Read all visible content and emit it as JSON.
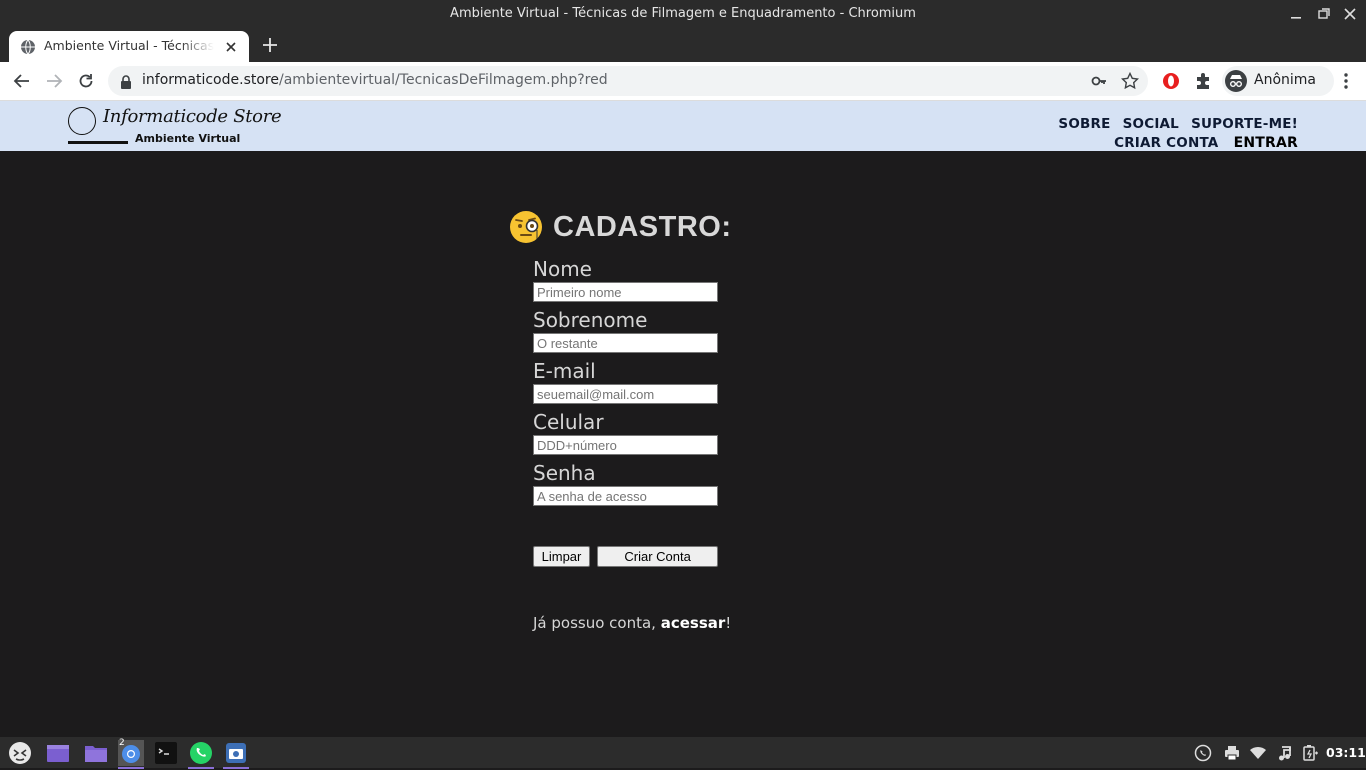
{
  "window": {
    "title": "Ambiente Virtual - Técnicas de Filmagem e Enquadramento - Chromium"
  },
  "tab": {
    "title": "Ambiente Virtual - Técnicas de Filmagem e Enquadramento"
  },
  "addressbar": {
    "host": "informaticode.store",
    "path": "/ambientevirtual/TecnicasDeFilmagem.php?red"
  },
  "profile": {
    "label": "Anônima"
  },
  "site": {
    "brand": "Informaticode Store",
    "subtitle": "Ambiente Virtual",
    "nav": {
      "sobre": "SOBRE",
      "social": "SOCIAL",
      "suporte": "SUPORTE-ME!",
      "criar_conta": "CRIAR CONTA",
      "entrar": "ENTRAR"
    }
  },
  "form": {
    "heading": "CADASTRO:",
    "fields": [
      {
        "label": "Nome",
        "placeholder": "Primeiro nome",
        "value": ""
      },
      {
        "label": "Sobrenome",
        "placeholder": "O restante",
        "value": ""
      },
      {
        "label": "E-mail",
        "placeholder": "seuemail@mail.com",
        "value": ""
      },
      {
        "label": "Celular",
        "placeholder": "DDD+número",
        "value": ""
      },
      {
        "label": "Senha",
        "placeholder": "A senha de acesso",
        "value": ""
      }
    ],
    "clear_label": "Limpar",
    "submit_label": "Criar Conta",
    "already_text": "Já possuo conta, ",
    "already_link": "acessar",
    "already_suffix": "!"
  },
  "taskbar": {
    "chromium_badge": "2",
    "clock": "03:11"
  },
  "colors": {
    "page_bg": "#1c1b1c",
    "header_bg": "#d6e2f4",
    "nav_text": "#0e1a33",
    "form_text": "#d6d6d6",
    "taskbar_accent": "#8a6fd6"
  }
}
